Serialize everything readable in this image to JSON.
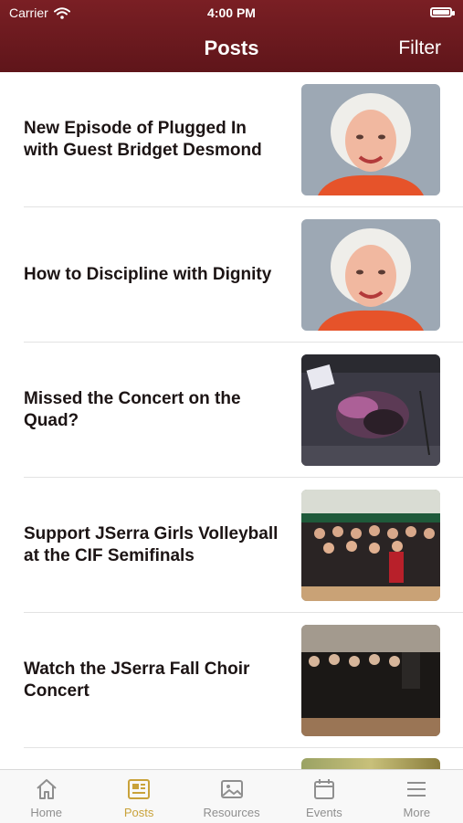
{
  "status": {
    "carrier": "Carrier",
    "time": "4:00 PM"
  },
  "header": {
    "title": "Posts",
    "filter_label": "Filter"
  },
  "posts": [
    {
      "title": "New Episode of Plugged In with Guest Bridget Desmond",
      "image": "portrait-photo"
    },
    {
      "title": "How to Discipline with Dignity",
      "image": "portrait-photo"
    },
    {
      "title": "Missed the Concert on the Quad?",
      "image": "concert-photo"
    },
    {
      "title": "Support JSerra Girls Volleyball at the CIF Semifinals",
      "image": "volleyball-team-photo"
    },
    {
      "title": "Watch the JSerra Fall Choir Concert",
      "image": "choir-photo"
    }
  ],
  "tabs": [
    {
      "label": "Home",
      "icon": "home-icon"
    },
    {
      "label": "Posts",
      "icon": "posts-icon",
      "active": true
    },
    {
      "label": "Resources",
      "icon": "image-icon"
    },
    {
      "label": "Events",
      "icon": "calendar-icon"
    },
    {
      "label": "More",
      "icon": "menu-icon"
    }
  ],
  "colors": {
    "header": "#6e1a1f",
    "accent": "#c9a23a",
    "tab_inactive": "#8f8f8f"
  }
}
